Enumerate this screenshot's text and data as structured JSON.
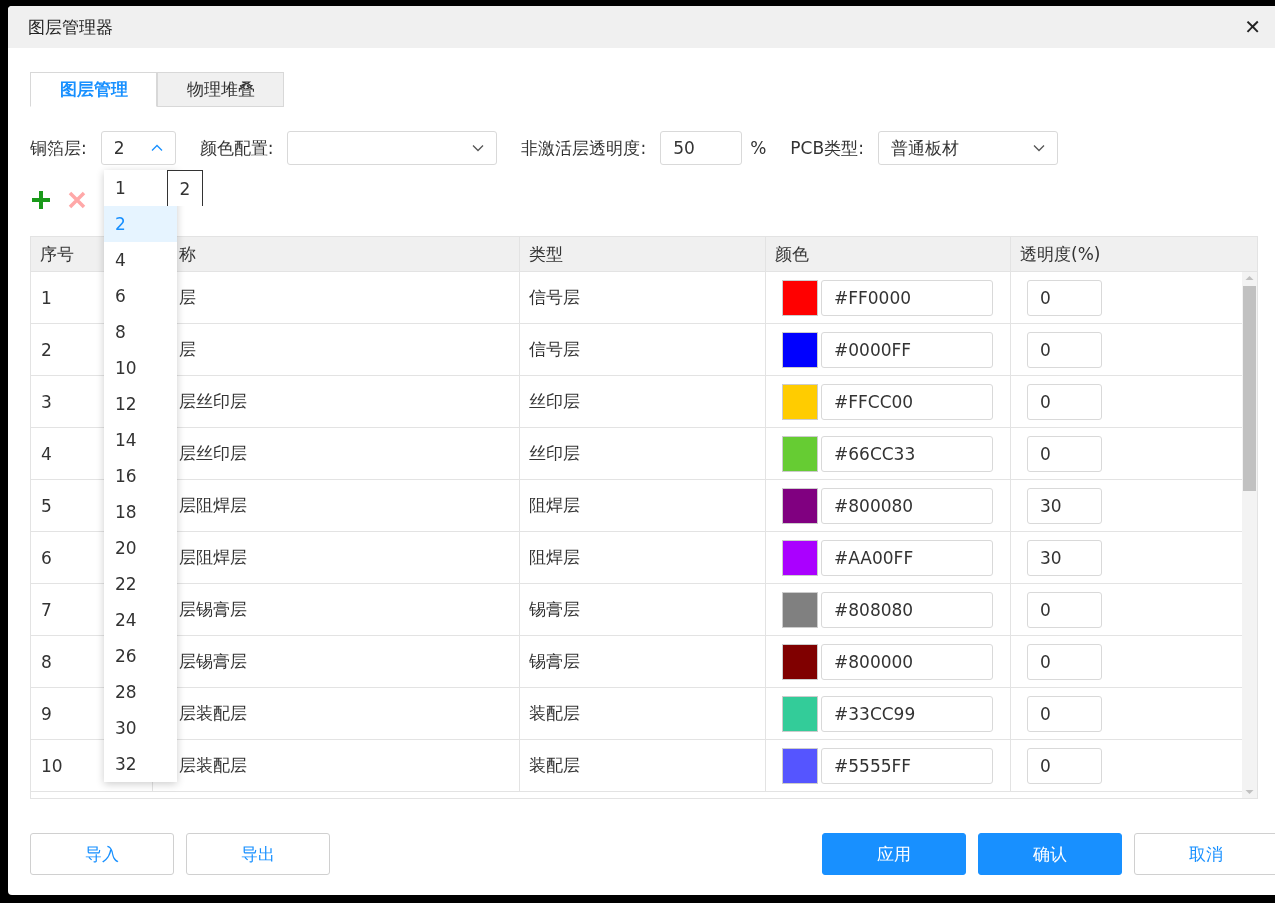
{
  "window": {
    "title": "图层管理器",
    "close": "✕"
  },
  "tabs": [
    {
      "label": "图层管理",
      "selected": true
    },
    {
      "label": "物理堆叠",
      "selected": false
    }
  ],
  "settings": {
    "copper_label": "铜箔层:",
    "copper_value": "2",
    "copper_expanded": true,
    "color_label": "颜色配置:",
    "opacity_label": "非激活层透明度:",
    "opacity_value": "50",
    "opacity_unit": "%",
    "pcb_label": "PCB类型:",
    "pcb_value": "普通板材"
  },
  "copper_options": [
    {
      "label": "1",
      "selected": false
    },
    {
      "label": "2",
      "selected": true
    },
    {
      "label": "4",
      "selected": false
    },
    {
      "label": "6",
      "selected": false
    },
    {
      "label": "8",
      "selected": false
    },
    {
      "label": "10",
      "selected": false
    },
    {
      "label": "12",
      "selected": false
    },
    {
      "label": "14",
      "selected": false
    },
    {
      "label": "16",
      "selected": false
    },
    {
      "label": "18",
      "selected": false
    },
    {
      "label": "20",
      "selected": false
    },
    {
      "label": "22",
      "selected": false
    },
    {
      "label": "24",
      "selected": false
    },
    {
      "label": "26",
      "selected": false
    },
    {
      "label": "28",
      "selected": false
    },
    {
      "label": "30",
      "selected": false
    },
    {
      "label": "32",
      "selected": false
    }
  ],
  "tooltip": "2",
  "table": {
    "columns": [
      "序号",
      "称",
      "类型",
      "颜色",
      "透明度(%)"
    ],
    "rows": [
      {
        "index": "1",
        "name": "层",
        "type": "信号层",
        "color": "#ff0000",
        "hex": "#FF0000",
        "opacity": "0"
      },
      {
        "index": "2",
        "name": "层",
        "type": "信号层",
        "color": "#0000ff",
        "hex": "#0000FF",
        "opacity": "0"
      },
      {
        "index": "3",
        "name": "层丝印层",
        "type": "丝印层",
        "color": "#ffcc00",
        "hex": "#FFCC00",
        "opacity": "0"
      },
      {
        "index": "4",
        "name": "层丝印层",
        "type": "丝印层",
        "color": "#66cc33",
        "hex": "#66CC33",
        "opacity": "0"
      },
      {
        "index": "5",
        "name": "层阻焊层",
        "type": "阻焊层",
        "color": "#800080",
        "hex": "#800080",
        "opacity": "30"
      },
      {
        "index": "6",
        "name": "层阻焊层",
        "type": "阻焊层",
        "color": "#aa00ff",
        "hex": "#AA00FF",
        "opacity": "30"
      },
      {
        "index": "7",
        "name": "层锡膏层",
        "type": "锡膏层",
        "color": "#808080",
        "hex": "#808080",
        "opacity": "0"
      },
      {
        "index": "8",
        "name": "层锡膏层",
        "type": "锡膏层",
        "color": "#800000",
        "hex": "#800000",
        "opacity": "0"
      },
      {
        "index": "9",
        "name": "层装配层",
        "type": "装配层",
        "color": "#33cc99",
        "hex": "#33CC99",
        "opacity": "0"
      },
      {
        "index": "10",
        "name": "层装配层",
        "type": "装配层",
        "color": "#5555ff",
        "hex": "#5555FF",
        "opacity": "0"
      }
    ]
  },
  "footer_left": [
    "导入",
    "导出"
  ],
  "footer_right": [
    {
      "label": "应用",
      "kind": "primary"
    },
    {
      "label": "确认",
      "kind": "primary"
    },
    {
      "label": "取消",
      "kind": "plain"
    }
  ]
}
